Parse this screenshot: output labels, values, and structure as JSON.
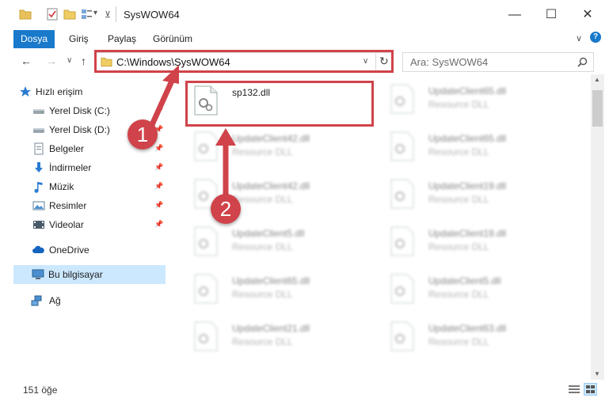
{
  "window": {
    "title": "SysWOW64",
    "minimize": "—",
    "maximize": "☐",
    "close": "✕"
  },
  "ribbon": {
    "tabs": [
      "Dosya",
      "Giriş",
      "Paylaş",
      "Görünüm"
    ],
    "collapse": "∨",
    "help": "?"
  },
  "nav": {
    "back": "←",
    "forward": "→",
    "recent": "∨",
    "up": "↑",
    "address": "C:\\Windows\\SysWOW64",
    "address_dropdown": "∨",
    "refresh": "↻",
    "search_placeholder": "Ara: SysWOW64"
  },
  "sidebar": {
    "items": [
      {
        "label": "Hızlı erişim",
        "icon": "star-icon",
        "pinned": false
      },
      {
        "label": "Yerel Disk (C:)",
        "icon": "drive-icon",
        "pinned": true
      },
      {
        "label": "Yerel Disk (D:)",
        "icon": "drive-icon",
        "pinned": true
      },
      {
        "label": "Belgeler",
        "icon": "documents-icon",
        "pinned": true
      },
      {
        "label": "İndirmeler",
        "icon": "download-icon",
        "pinned": true
      },
      {
        "label": "Müzik",
        "icon": "music-icon",
        "pinned": true
      },
      {
        "label": "Resimler",
        "icon": "pictures-icon",
        "pinned": true
      },
      {
        "label": "Videolar",
        "icon": "videos-icon",
        "pinned": true
      },
      {
        "label": "OneDrive",
        "icon": "cloud-icon",
        "pinned": false
      },
      {
        "label": "Bu bilgisayar",
        "icon": "computer-icon",
        "pinned": false,
        "selected": true
      },
      {
        "label": "Ağ",
        "icon": "network-icon",
        "pinned": false
      }
    ]
  },
  "files": {
    "left": [
      {
        "name": "sp132.dll",
        "type": ""
      },
      {
        "name": "UpdateClient42.dll",
        "type": "Resource DLL"
      },
      {
        "name": "UpdateClient42.dll",
        "type": "Resource DLL"
      },
      {
        "name": "UpdateClient5.dll",
        "type": "Resource DLL"
      },
      {
        "name": "UpdateClient65.dll",
        "type": "Resource DLL"
      },
      {
        "name": "UpdateClient21.dll",
        "type": "Resource DLL"
      }
    ],
    "right": [
      {
        "name": "UpdateClient65.dll",
        "type": "Resource DLL"
      },
      {
        "name": "UpdateClient65.dll",
        "type": "Resource DLL"
      },
      {
        "name": "UpdateClient19.dll",
        "type": "Resource DLL"
      },
      {
        "name": "UpdateClient19.dll",
        "type": "Resource DLL"
      },
      {
        "name": "UpdateClient5.dll",
        "type": "Resource DLL"
      },
      {
        "name": "UpdateClient63.dll",
        "type": "Resource DLL"
      }
    ]
  },
  "status": {
    "count": "151 öğe"
  },
  "annotations": {
    "step1": "1",
    "step2": "2",
    "color": "#d0434a"
  },
  "colors": {
    "accent": "#1979ca",
    "selected": "#cce8ff"
  }
}
